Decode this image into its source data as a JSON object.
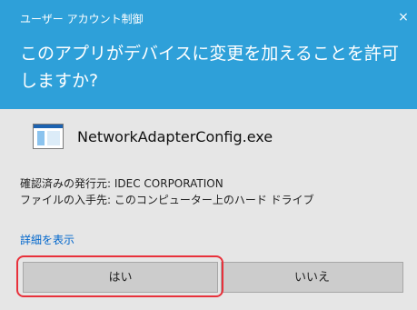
{
  "dialog": {
    "caption": "ユーザー アカウント制御",
    "prompt": "このアプリがデバイスに変更を加えることを許可しますか?"
  },
  "app": {
    "name": "NetworkAdapterConfig.exe",
    "icon": "application-window-icon"
  },
  "info": {
    "publisher": "確認済みの発行元: IDEC CORPORATION",
    "origin": "ファイルの入手先: このコンピューター上のハード ドライブ"
  },
  "links": {
    "details": "詳細を表示"
  },
  "buttons": {
    "yes": "はい",
    "no": "いいえ"
  },
  "icons": {
    "close": "×"
  },
  "colors": {
    "header": "#2ea0d9",
    "body": "#e6e6e6",
    "link": "#0066cc",
    "highlight": "#e8313b"
  }
}
